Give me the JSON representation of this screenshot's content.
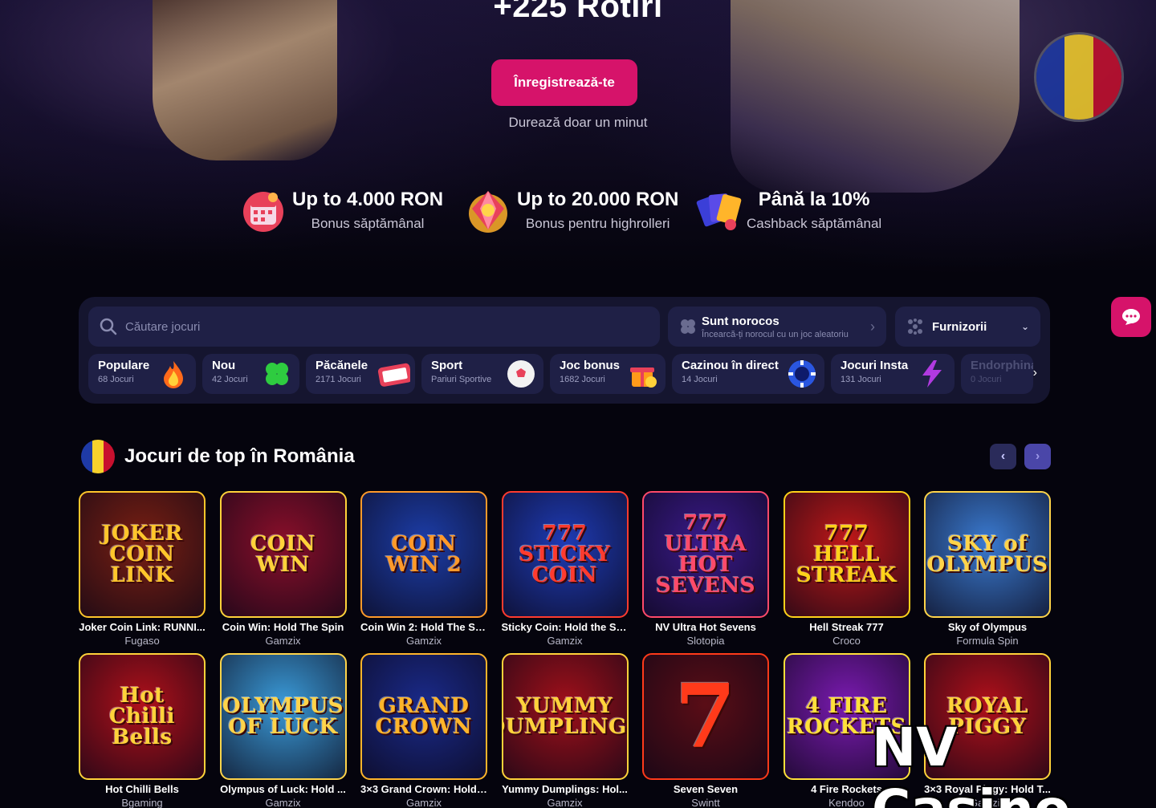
{
  "hero": {
    "title": "+225 Rotiri",
    "register_label": "Înregistrează-te",
    "subtitle": "Durează doar un minut",
    "flag_colors": [
      "#1e3aa6",
      "#f7d12c",
      "#c8102e"
    ]
  },
  "promos": [
    {
      "title": "Up to 4.000 RON",
      "subtitle": "Bonus săptămânal",
      "icon": "calendar-gift-icon"
    },
    {
      "title": "Up to 20.000 RON",
      "subtitle": "Bonus pentru highrolleri",
      "icon": "diamond-icon"
    },
    {
      "title": "Până la 10%",
      "subtitle": "Cashback săptămânal",
      "icon": "cashback-cards-icon"
    }
  ],
  "search": {
    "placeholder": "Căutare jocuri",
    "lucky_title": "Sunt norocos",
    "lucky_subtitle": "Încearcă-ți norocul cu un joc aleatoriu",
    "providers_label": "Furnizorii"
  },
  "categories": [
    {
      "name": "Populare",
      "count": "68 Jocuri",
      "icon": "fire-icon",
      "color": "#ff6a1a"
    },
    {
      "name": "Nou",
      "count": "42 Jocuri",
      "icon": "clover-icon",
      "color": "#2ecc40"
    },
    {
      "name": "Păcănele",
      "count": "2171 Jocuri",
      "icon": "slot-machine-icon",
      "color": "#e8415a"
    },
    {
      "name": "Sport",
      "count": "Pariuri Sportive",
      "icon": "soccer-ball-icon",
      "color": "#f2f2f2"
    },
    {
      "name": "Joc bonus",
      "count": "1682 Jocuri",
      "icon": "gift-box-icon",
      "color": "#ff9a1a"
    },
    {
      "name": "Cazinou în direct",
      "count": "14 Jocuri",
      "icon": "poker-chip-icon",
      "color": "#2a56e0"
    },
    {
      "name": "Jocuri Insta",
      "count": "131 Jocuri",
      "icon": "lightning-icon",
      "color": "#b03ae0"
    },
    {
      "name": "Endorphina",
      "count": "0 Jocuri",
      "icon": "",
      "color": ""
    }
  ],
  "top_games": {
    "title": "Jocuri de top în România",
    "prev_label": "‹",
    "next_label": "›",
    "games": [
      {
        "title": "Joker Coin Link: RUNNI...",
        "provider": "Fugaso",
        "art": "JOKER COIN LINK",
        "bg": "#7a1f12",
        "fg": "#ffc62b"
      },
      {
        "title": "Coin Win: Hold The Spin",
        "provider": "Gamzix",
        "art": "COIN WIN",
        "bg": "#8a0f2a",
        "fg": "#ffd23a"
      },
      {
        "title": "Coin Win 2: Hold The Spin",
        "provider": "Gamzix",
        "art": "COIN WIN 2",
        "bg": "#1c3da8",
        "fg": "#ff9a2a"
      },
      {
        "title": "Sticky Coin: Hold the Spin",
        "provider": "Gamzix",
        "art": "777 STICKY COIN",
        "bg": "#1e3bb5",
        "fg": "#ff3b2f"
      },
      {
        "title": "NV Ultra Hot Sevens",
        "provider": "Slotopia",
        "art": "777 ULTRA HOT SEVENS",
        "bg": "#3a1a8a",
        "fg": "#ff4a6a"
      },
      {
        "title": "Hell Streak 777",
        "provider": "Croco",
        "art": "777 HELL STREAK",
        "bg": "#c01818",
        "fg": "#ffd21a"
      },
      {
        "title": "Sky of Olympus",
        "provider": "Formula Spin",
        "art": "SKY of OLYMPUS",
        "bg": "#3a7ad0",
        "fg": "#ffd44a"
      },
      {
        "title": "Hot Chilli Bells",
        "provider": "Bgaming",
        "art": "Hot Chilli Bells",
        "bg": "#b0101a",
        "fg": "#ffd23a"
      },
      {
        "title": "Olympus of Luck: Hold ...",
        "provider": "Gamzix",
        "art": "OLYMPUS OF LUCK",
        "bg": "#3a9ad8",
        "fg": "#ffd44a"
      },
      {
        "title": "3×3 Grand Crown: Hold ...",
        "provider": "Gamzix",
        "art": "GRAND CROWN",
        "bg": "#1a2a8a",
        "fg": "#ffb52a"
      },
      {
        "title": "Yummy Dumplings: Hol...",
        "provider": "Gamzix",
        "art": "YUMMY DUMPLINGS",
        "bg": "#a0101a",
        "fg": "#ffd23a"
      },
      {
        "title": "Seven Seven",
        "provider": "Swintt",
        "art": "7",
        "bg": "#5a0d16",
        "fg": "#ff3a1a"
      },
      {
        "title": "4 Fire Rockets",
        "provider": "Kendoo",
        "art": "4 FIRE ROCKETS",
        "bg": "#7a1ab0",
        "fg": "#ffe03a"
      },
      {
        "title": "3×3 Royal Piggy: Hold T...",
        "provider": "Gamzix",
        "art": "ROYAL PIGGY",
        "bg": "#b0101a",
        "fg": "#ffd23a"
      }
    ]
  },
  "watermark": "NV Casino"
}
